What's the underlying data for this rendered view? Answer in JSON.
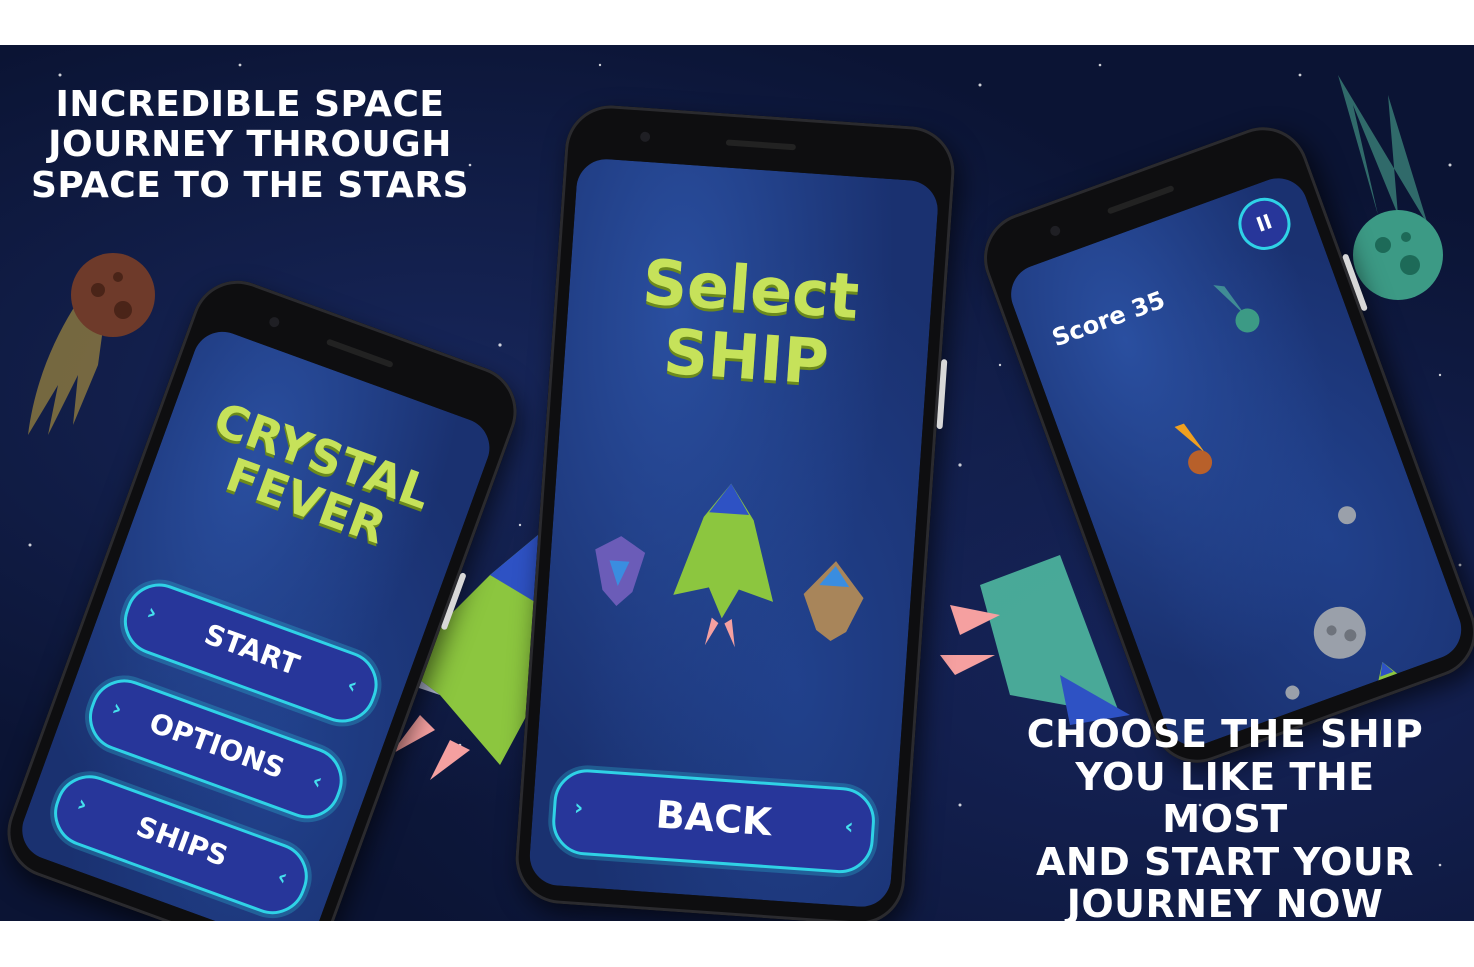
{
  "promo": {
    "left_lines": [
      "INCREDIBLE SPACE",
      "JOURNEY THROUGH",
      "SPACE TO THE STARS"
    ],
    "right_lines": [
      "CHOOSE THE SHIP",
      "YOU LIKE THE MOST",
      "AND START YOUR",
      "JOURNEY NOW"
    ]
  },
  "main_menu": {
    "title_lines": [
      "CRYSTAL",
      "FEVER"
    ],
    "buttons": [
      "START",
      "OPTIONS",
      "SHIPS"
    ]
  },
  "ship_select": {
    "title_lines": [
      "Select",
      "SHIP"
    ],
    "back_label": "BACK"
  },
  "gameplay": {
    "score_label": "Score 35",
    "pause_glyph": "II"
  },
  "colors": {
    "background": "#0b1434",
    "title_green": "#c6e25a",
    "button_fill": "#27369a",
    "button_border": "#2fd2e6",
    "ship_green": "#8cc63f"
  }
}
